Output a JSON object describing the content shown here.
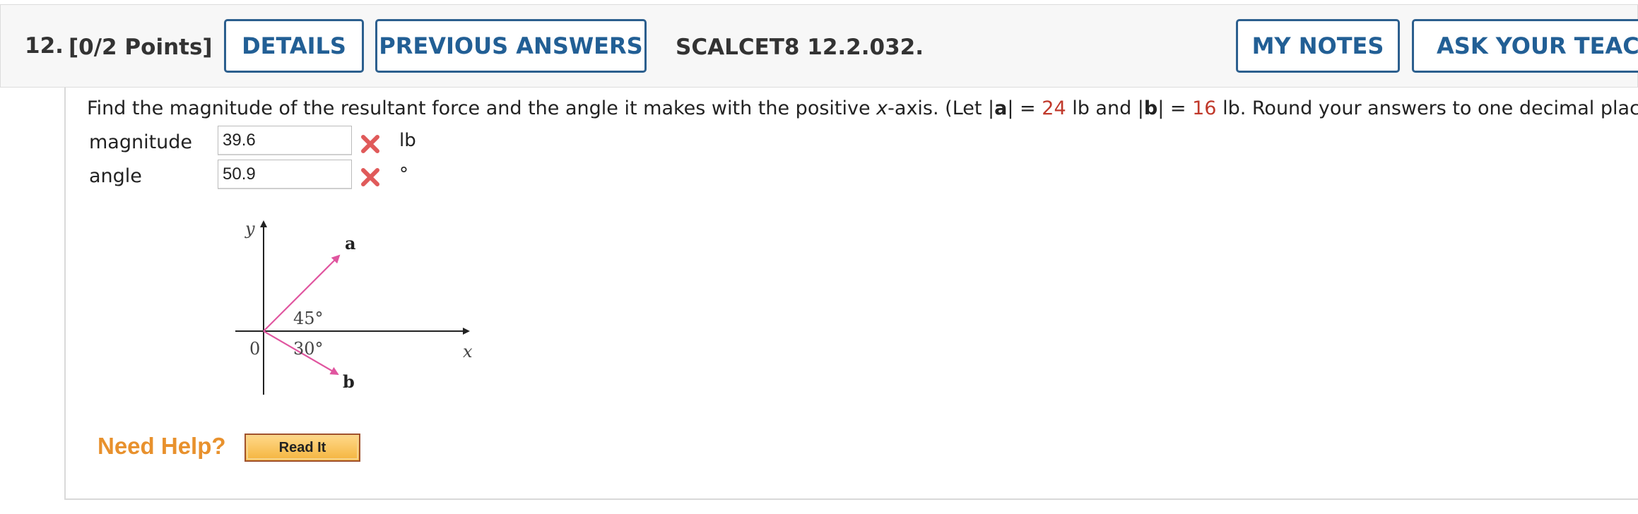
{
  "question": {
    "number": "12.",
    "points": "[0/2 Points]",
    "source": "SCALCET8 12.2.032."
  },
  "header_buttons": {
    "details": "DETAILS",
    "previous_answers": "PREVIOUS ANSWERS",
    "my_notes": "MY NOTES",
    "ask_teacher": "ASK YOUR TEACHE"
  },
  "prompt": {
    "part1": "Find the magnitude of the resultant force and the angle it makes with the positive ",
    "x_var": "x",
    "part2": "-axis. (Let |",
    "a": "a",
    "part3": "| = ",
    "a_value": "24",
    "part4": " lb and |",
    "b": "b",
    "part5": "| = ",
    "b_value": "16",
    "part6": " lb. Round your answers to one decimal place.)"
  },
  "answers": {
    "magnitude": {
      "label": "magnitude",
      "value": "39.6",
      "unit": "lb",
      "status": "incorrect"
    },
    "angle": {
      "label": "angle",
      "value": "50.9",
      "unit": "°",
      "status": "incorrect"
    }
  },
  "diagram": {
    "y_label": "y",
    "x_label": "x",
    "origin_label": "0",
    "vector_a_label": "a",
    "vector_b_label": "b",
    "angle_a": "45°",
    "angle_b": "30°",
    "vector_color": "#e0559f"
  },
  "help": {
    "need_help": "Need Help?",
    "read_it": "Read It"
  },
  "colors": {
    "button_border": "#2c5f8e",
    "button_text": "#225f95",
    "given_value": "#c0392b",
    "incorrect_mark": "#e05a5a",
    "need_help": "#e8912d"
  }
}
